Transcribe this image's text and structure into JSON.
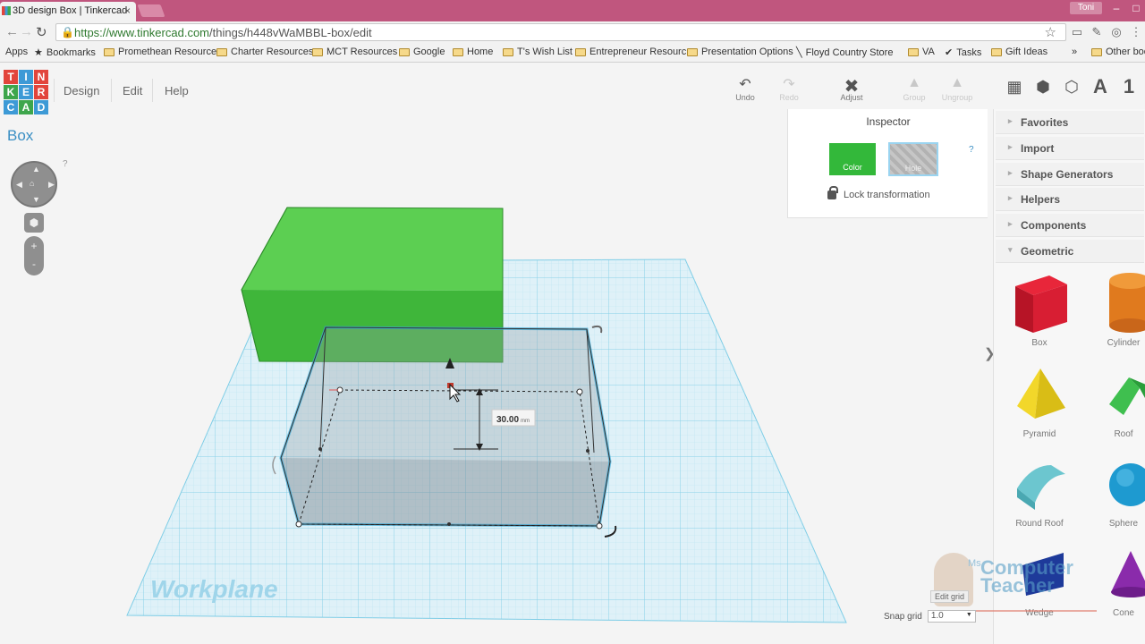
{
  "browser": {
    "tab_title": "3D design Box | Tinkercad",
    "tab_close": "×",
    "user_name": "Toni",
    "window_buttons": [
      "–",
      "□",
      "×"
    ],
    "url_host": "https://www.tinkercad.com",
    "url_path": "/things/h448vWaMBBL-box/edit"
  },
  "bookmarks": [
    "Apps",
    "Bookmarks",
    "Promethean Resource",
    "Charter Resources",
    "MCT Resources",
    "Google",
    "Home",
    "T's Wish List",
    "Entrepreneur Resourc",
    "Presentation Options",
    "Floyd Country Store",
    "VA",
    "Tasks",
    "Gift Ideas",
    "»",
    "Other boo"
  ],
  "app": {
    "logo_letters": [
      "T",
      "I",
      "N",
      "K",
      "E",
      "R",
      "C",
      "A",
      "D"
    ],
    "logo_colors": [
      "#e2453c",
      "#3d9ad6",
      "#e2453c",
      "#3ea64c",
      "#3d9ad6",
      "#e2453c",
      "#3d9ad6",
      "#3ea64c",
      "#3d9ad6"
    ],
    "menu": [
      "Design",
      "Edit",
      "Help"
    ],
    "design_name": "Box",
    "toolbar": {
      "undo": "Undo",
      "redo": "Redo",
      "adjust": "Adjust",
      "group": "Group",
      "ungroup": "Ungroup"
    },
    "view_icons": [
      "grid-view-icon",
      "box-view-icon",
      "wire-view-icon",
      "text-A-icon",
      "number-1-icon"
    ],
    "nav_help": "?"
  },
  "inspector": {
    "title": "Inspector",
    "color_label": "Color",
    "hole_label": "Hole",
    "help": "?",
    "lock_label": "Lock transformation"
  },
  "right_panel": {
    "categories": [
      "Favorites",
      "Import",
      "Shape Generators",
      "Helpers",
      "Components",
      "Geometric"
    ],
    "shapes": [
      "Box",
      "Cylinder",
      "Pyramid",
      "Roof",
      "Round Roof",
      "Sphere",
      "Wedge",
      "Cone"
    ]
  },
  "canvas": {
    "workplane_label": "Workplane",
    "dimension_value": "30.00",
    "dimension_unit": "mm",
    "green_box_color": "#3fb63a",
    "grid_color": "#7ecde6"
  },
  "snap": {
    "label": "Snap grid",
    "value": "1.0",
    "edit_grid": "Edit grid"
  },
  "watermark": {
    "ms": "Ms",
    "line1": "Computer",
    "line2": "Teacher"
  }
}
